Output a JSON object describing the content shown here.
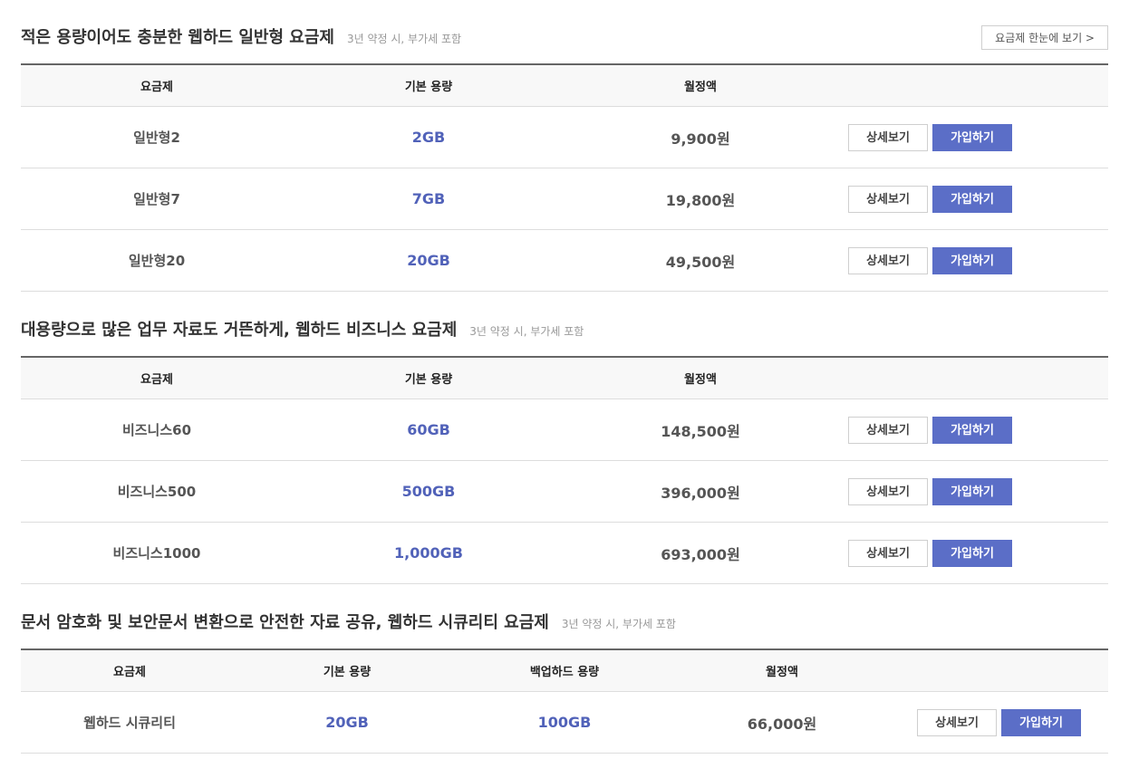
{
  "sections": [
    {
      "title": "적은 용량이어도 충분한 웹하드 일반형 요금제",
      "note": "3년 약정 시, 부가세 포함",
      "overview_button": "요금제 한눈에 보기 >",
      "headers": [
        "요금제",
        "기본 용량",
        "월정액"
      ],
      "rows": [
        {
          "name": "일반형2",
          "capacity": "2GB",
          "price": "9,900원"
        },
        {
          "name": "일반형7",
          "capacity": "7GB",
          "price": "19,800원"
        },
        {
          "name": "일반형20",
          "capacity": "20GB",
          "price": "49,500원"
        }
      ]
    },
    {
      "title": "대용량으로 많은 업무 자료도 거뜬하게, 웹하드 비즈니스 요금제",
      "note": "3년 약정 시, 부가세 포함",
      "headers": [
        "요금제",
        "기본 용량",
        "월정액"
      ],
      "rows": [
        {
          "name": "비즈니스60",
          "capacity": "60GB",
          "price": "148,500원"
        },
        {
          "name": "비즈니스500",
          "capacity": "500GB",
          "price": "396,000원"
        },
        {
          "name": "비즈니스1000",
          "capacity": "1,000GB",
          "price": "693,000원"
        }
      ]
    },
    {
      "title": "문서 암호화 및 보안문서 변환으로 안전한 자료 공유, 웹하드 시큐리티 요금제",
      "note": "3년 약정 시, 부가세 포함",
      "headers": [
        "요금제",
        "기본 용량",
        "백업하드 용량",
        "월정액"
      ],
      "rows": [
        {
          "name": "웹하드 시큐리티",
          "capacity": "20GB",
          "backup": "100GB",
          "price": "66,000원"
        }
      ]
    }
  ],
  "buttons": {
    "detail": "상세보기",
    "join": "가입하기"
  },
  "colors": {
    "accent": "#5b6ec7",
    "capacity_text": "#5162b9",
    "header_border": "#666666",
    "row_border": "#dddddd"
  }
}
